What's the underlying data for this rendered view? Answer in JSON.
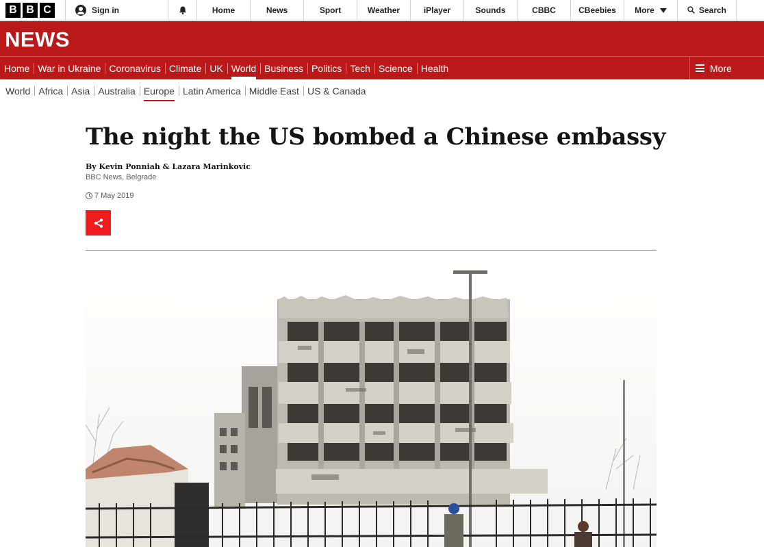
{
  "global_nav": {
    "logo_letters": [
      "B",
      "B",
      "C"
    ],
    "sign_in": "Sign in",
    "items": [
      "Home",
      "News",
      "Sport",
      "Weather",
      "iPlayer",
      "Sounds",
      "CBBC",
      "CBeebies",
      "More"
    ],
    "search": "Search"
  },
  "brand": "NEWS",
  "main_nav": {
    "items": [
      "Home",
      "War in Ukraine",
      "Coronavirus",
      "Climate",
      "UK",
      "World",
      "Business",
      "Politics",
      "Tech",
      "Science",
      "Health"
    ],
    "active": "World",
    "more": "More"
  },
  "sub_nav": {
    "items": [
      "World",
      "Africa",
      "Asia",
      "Australia",
      "Europe",
      "Latin America",
      "Middle East",
      "US & Canada"
    ],
    "active": "Europe"
  },
  "article": {
    "headline": "The night the US bombed a Chinese embassy",
    "byline": "By Kevin Ponniah & Lazara Marinkovic",
    "byline_sub": "BBC News, Belgrade",
    "date": "7 May 2019"
  },
  "colors": {
    "news_red": "#bb1919",
    "share_red": "#ee1c1c"
  },
  "icons": {
    "signin": "user-icon",
    "notifications": "bell-icon",
    "more_caret": "caret-down-icon",
    "search": "search-icon",
    "menu": "hamburger-icon",
    "timestamp": "clock-icon",
    "share": "share-icon"
  }
}
